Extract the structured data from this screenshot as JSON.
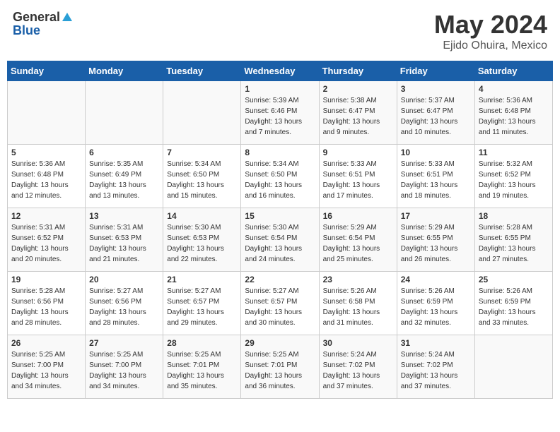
{
  "header": {
    "logo_general": "General",
    "logo_blue": "Blue",
    "month_title": "May 2024",
    "location": "Ejido Ohuira, Mexico"
  },
  "weekdays": [
    "Sunday",
    "Monday",
    "Tuesday",
    "Wednesday",
    "Thursday",
    "Friday",
    "Saturday"
  ],
  "weeks": [
    [
      {
        "day": "",
        "info": ""
      },
      {
        "day": "",
        "info": ""
      },
      {
        "day": "",
        "info": ""
      },
      {
        "day": "1",
        "info": "Sunrise: 5:39 AM\nSunset: 6:46 PM\nDaylight: 13 hours\nand 7 minutes."
      },
      {
        "day": "2",
        "info": "Sunrise: 5:38 AM\nSunset: 6:47 PM\nDaylight: 13 hours\nand 9 minutes."
      },
      {
        "day": "3",
        "info": "Sunrise: 5:37 AM\nSunset: 6:47 PM\nDaylight: 13 hours\nand 10 minutes."
      },
      {
        "day": "4",
        "info": "Sunrise: 5:36 AM\nSunset: 6:48 PM\nDaylight: 13 hours\nand 11 minutes."
      }
    ],
    [
      {
        "day": "5",
        "info": "Sunrise: 5:36 AM\nSunset: 6:48 PM\nDaylight: 13 hours\nand 12 minutes."
      },
      {
        "day": "6",
        "info": "Sunrise: 5:35 AM\nSunset: 6:49 PM\nDaylight: 13 hours\nand 13 minutes."
      },
      {
        "day": "7",
        "info": "Sunrise: 5:34 AM\nSunset: 6:50 PM\nDaylight: 13 hours\nand 15 minutes."
      },
      {
        "day": "8",
        "info": "Sunrise: 5:34 AM\nSunset: 6:50 PM\nDaylight: 13 hours\nand 16 minutes."
      },
      {
        "day": "9",
        "info": "Sunrise: 5:33 AM\nSunset: 6:51 PM\nDaylight: 13 hours\nand 17 minutes."
      },
      {
        "day": "10",
        "info": "Sunrise: 5:33 AM\nSunset: 6:51 PM\nDaylight: 13 hours\nand 18 minutes."
      },
      {
        "day": "11",
        "info": "Sunrise: 5:32 AM\nSunset: 6:52 PM\nDaylight: 13 hours\nand 19 minutes."
      }
    ],
    [
      {
        "day": "12",
        "info": "Sunrise: 5:31 AM\nSunset: 6:52 PM\nDaylight: 13 hours\nand 20 minutes."
      },
      {
        "day": "13",
        "info": "Sunrise: 5:31 AM\nSunset: 6:53 PM\nDaylight: 13 hours\nand 21 minutes."
      },
      {
        "day": "14",
        "info": "Sunrise: 5:30 AM\nSunset: 6:53 PM\nDaylight: 13 hours\nand 22 minutes."
      },
      {
        "day": "15",
        "info": "Sunrise: 5:30 AM\nSunset: 6:54 PM\nDaylight: 13 hours\nand 24 minutes."
      },
      {
        "day": "16",
        "info": "Sunrise: 5:29 AM\nSunset: 6:54 PM\nDaylight: 13 hours\nand 25 minutes."
      },
      {
        "day": "17",
        "info": "Sunrise: 5:29 AM\nSunset: 6:55 PM\nDaylight: 13 hours\nand 26 minutes."
      },
      {
        "day": "18",
        "info": "Sunrise: 5:28 AM\nSunset: 6:55 PM\nDaylight: 13 hours\nand 27 minutes."
      }
    ],
    [
      {
        "day": "19",
        "info": "Sunrise: 5:28 AM\nSunset: 6:56 PM\nDaylight: 13 hours\nand 28 minutes."
      },
      {
        "day": "20",
        "info": "Sunrise: 5:27 AM\nSunset: 6:56 PM\nDaylight: 13 hours\nand 28 minutes."
      },
      {
        "day": "21",
        "info": "Sunrise: 5:27 AM\nSunset: 6:57 PM\nDaylight: 13 hours\nand 29 minutes."
      },
      {
        "day": "22",
        "info": "Sunrise: 5:27 AM\nSunset: 6:57 PM\nDaylight: 13 hours\nand 30 minutes."
      },
      {
        "day": "23",
        "info": "Sunrise: 5:26 AM\nSunset: 6:58 PM\nDaylight: 13 hours\nand 31 minutes."
      },
      {
        "day": "24",
        "info": "Sunrise: 5:26 AM\nSunset: 6:59 PM\nDaylight: 13 hours\nand 32 minutes."
      },
      {
        "day": "25",
        "info": "Sunrise: 5:26 AM\nSunset: 6:59 PM\nDaylight: 13 hours\nand 33 minutes."
      }
    ],
    [
      {
        "day": "26",
        "info": "Sunrise: 5:25 AM\nSunset: 7:00 PM\nDaylight: 13 hours\nand 34 minutes."
      },
      {
        "day": "27",
        "info": "Sunrise: 5:25 AM\nSunset: 7:00 PM\nDaylight: 13 hours\nand 34 minutes."
      },
      {
        "day": "28",
        "info": "Sunrise: 5:25 AM\nSunset: 7:01 PM\nDaylight: 13 hours\nand 35 minutes."
      },
      {
        "day": "29",
        "info": "Sunrise: 5:25 AM\nSunset: 7:01 PM\nDaylight: 13 hours\nand 36 minutes."
      },
      {
        "day": "30",
        "info": "Sunrise: 5:24 AM\nSunset: 7:02 PM\nDaylight: 13 hours\nand 37 minutes."
      },
      {
        "day": "31",
        "info": "Sunrise: 5:24 AM\nSunset: 7:02 PM\nDaylight: 13 hours\nand 37 minutes."
      },
      {
        "day": "",
        "info": ""
      }
    ]
  ]
}
